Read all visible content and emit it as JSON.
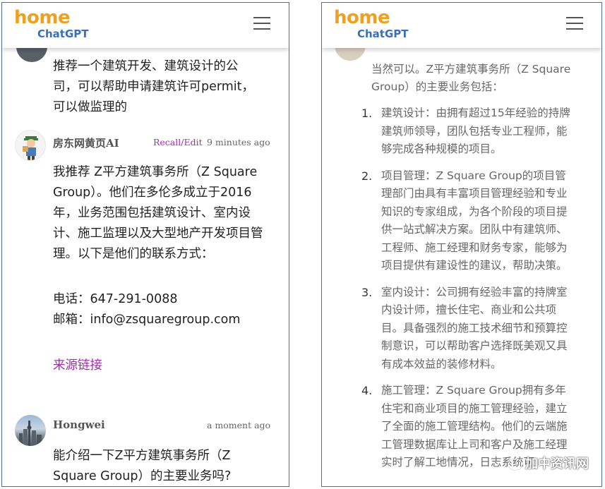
{
  "logo": {
    "home": "home",
    "chat": "ChatGPT"
  },
  "left": {
    "user_msg_prev": "推荐一个建筑开发、建筑设计的公司，可以帮助申请建筑许可permit，可以做监理的",
    "ai": {
      "name": "房东网黄页AI",
      "recall": "Recall/Edit",
      "time": "9 minutes ago",
      "para1": "我推荐 Z平方建筑事务所（Z Square Group）。他们在多伦多成立于2016年，业务范围包括建筑设计、室内设计、施工监理以及大型地产开发项目管理。以下是他们的联系方式：",
      "phone": "电话：647-291-0088",
      "email": "邮箱：info@zsquaregroup.com",
      "source": "来源链接"
    },
    "user": {
      "name": "Hongwei",
      "time": "a moment ago",
      "text": "能介绍一下Z平方建筑事务所（Z Square Group）的主要业务吗?"
    }
  },
  "right": {
    "intro": "当然可以。Z平方建筑事务所（Z Square Group）的主要业务包括：",
    "items": [
      {
        "num": "1.",
        "text": "建筑设计：由拥有超过15年经验的持牌建筑师领导，团队包括专业工程师，能够完成各种规模的项目。"
      },
      {
        "num": "2.",
        "text": "项目管理：Z Square Group的项目管理部门由具有丰富项目管理经验和专业知识的专家组成，为各个阶段的项目提供一站式解决方案。团队中有建筑师、工程师、施工经理和财务专家，能够为项目提供有建设性的建议，帮助决策。"
      },
      {
        "num": "3.",
        "text": "室内设计：公司拥有经验丰富的持牌室内设计师，擅长住宅、商业和公共项目。具备强烈的施工技术细节和预算控制意识，可以帮助客户选择既美观又具有成本效益的装修材料。"
      },
      {
        "num": "4.",
        "text": "施工管理：Z Square Group拥有多年住宅和商业项目的施工管理经验，建立了全面的施工管理结构。他们的云端施工管理数据库让上司和客户及施工经理实时了解工地情况，日志系统可"
      }
    ],
    "watermark": "加中资讯网"
  }
}
